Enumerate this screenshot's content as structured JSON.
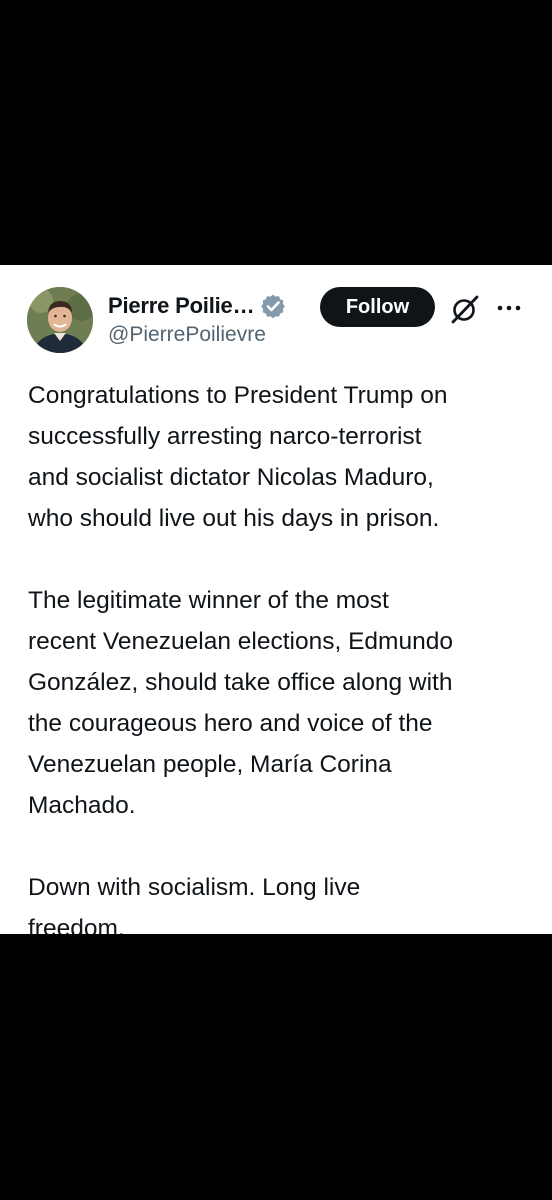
{
  "post": {
    "author": {
      "display_name": "Pierre Poilie…",
      "handle": "@PierrePoilievre",
      "verified": true,
      "avatar_icon": "profile-photo"
    },
    "actions": {
      "follow_label": "Follow",
      "grok_icon": "grok-icon",
      "more_icon": "more-options-icon"
    },
    "paragraphs": [
      {
        "lines": [
          "Congratulations to President Trump on",
          "successfully arresting narco-terrorist",
          "and socialist dictator Nicolas Maduro,",
          "who should live out his days in prison."
        ]
      },
      {
        "lines": [
          "The legitimate winner of the most",
          "recent Venezuelan elections, Edmundo",
          "González, should take office along with",
          "the courageous hero and voice of the",
          "Venezuelan people, María Corina",
          "Machado."
        ]
      },
      {
        "lines": [
          "Down with socialism. Long live",
          "freedom."
        ]
      }
    ]
  },
  "colors": {
    "background": "#000000",
    "card": "#ffffff",
    "text_primary": "#0f1419",
    "text_secondary": "#536471",
    "verified_badge": "#829aab",
    "follow_button": "#0f1419"
  }
}
